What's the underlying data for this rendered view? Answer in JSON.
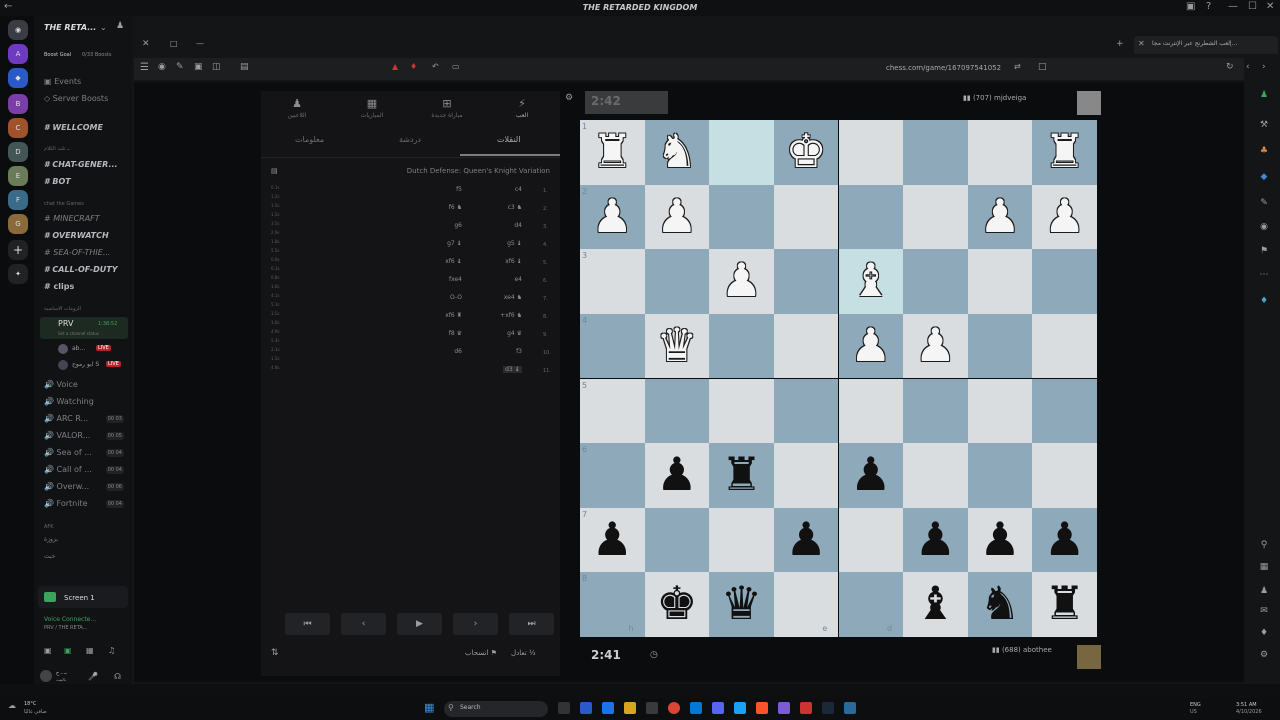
{
  "window": {
    "title": "THE RETARDED KINGDOM",
    "controls": [
      "✕",
      "—",
      "☐",
      "✕"
    ]
  },
  "discord": {
    "server_name": "THE RETA...",
    "boost_goal": "Boost Goal",
    "boosts": "0/33 Boosts",
    "events": "Events",
    "server_boosts": "Server Boosts",
    "channels": [
      {
        "label": "WELLCOME",
        "style": "bold"
      },
      {
        "label": "CHAT-GENER...",
        "style": "bold"
      },
      {
        "label": "BOT",
        "style": "bold"
      },
      {
        "label": "MINECRAFT",
        "style": "dim"
      },
      {
        "label": "OVERWATCH",
        "style": "bold"
      },
      {
        "label": "SEA-OF-THIE...",
        "style": "dim"
      },
      {
        "label": "CALL-OF-DUTY",
        "style": "bold"
      },
      {
        "label": "clips",
        "style": "bold"
      }
    ],
    "categories": {
      "c1": "ــ ثلث الكلام",
      "c2": "chat the Games",
      "c3": "الرومات الاساسية",
      "c4": "AFK"
    },
    "prv": {
      "label": "PRV",
      "time": "1:38:52",
      "status": "Set a channel status",
      "user1": "ab...",
      "user2": "ابو رموح S",
      "live": "LIVE"
    },
    "voice_channels": [
      {
        "label": "Voice",
        "count": ""
      },
      {
        "label": "Watching",
        "count": ""
      },
      {
        "label": "ARC R...",
        "count": "00 03"
      },
      {
        "label": "VALOR...",
        "count": "00 05"
      },
      {
        "label": "Sea of ...",
        "count": "00 04"
      },
      {
        "label": "Call of ...",
        "count": "00 04"
      },
      {
        "label": "Overw...",
        "count": "00 06"
      },
      {
        "label": "Fortnite",
        "count": "00 04"
      }
    ],
    "afk1": "بزوزة",
    "afk2": "خبث",
    "screen": "Screen 1",
    "voice_connected": "Voice Connecte...",
    "voice_path": "PRV / THE RETA...",
    "user_name": "ــ ـ ح",
    "user_status": "بالبيت"
  },
  "browser": {
    "tab_title": "إلعب الشطرنج عبر الإنترنت مجا...",
    "url": "chess.com/game/167097541052"
  },
  "chess": {
    "nav": [
      "العب",
      "مباراة جديدة",
      "المباريات",
      "اللاعبين"
    ],
    "tabs": [
      "النقلات",
      "دردشة",
      "معلومات"
    ],
    "opening": "Dutch Defense: Queen's Knight Variation",
    "moves": [
      {
        "n": "1.",
        "w": "c4",
        "b": "f5"
      },
      {
        "n": "2.",
        "w": "c3 ♞",
        "b": "f6 ♞"
      },
      {
        "n": "3.",
        "w": "d4",
        "b": "g6"
      },
      {
        "n": "4.",
        "w": "g5 ♝",
        "b": "g7 ♝"
      },
      {
        "n": "5.",
        "w": "xf6 ♝",
        "b": "xf6 ♝"
      },
      {
        "n": "6.",
        "w": "e4",
        "b": "fxe4"
      },
      {
        "n": "7.",
        "w": "xe4 ♞",
        "b": "O-O"
      },
      {
        "n": "8.",
        "w": "+xf6 ♞",
        "b": "xf6 ♜"
      },
      {
        "n": "9.",
        "w": "g4 ♛",
        "b": "f8 ♛"
      },
      {
        "n": "10.",
        "w": "f3",
        "b": "d6"
      },
      {
        "n": "11.",
        "w": "d3 ♝",
        "b": ""
      }
    ],
    "times": [
      "0.1s",
      "1.2s",
      "1.5s",
      "1.5s",
      "3.5s",
      "2.9s",
      "1.8s",
      "5.5s",
      "0.9s",
      "6.1s",
      "0.8s",
      "1.6s",
      "4.1s",
      "5.1s",
      "3.5s",
      "1.6s",
      "4.9s",
      "5.4s",
      "2.1s",
      "1.5s",
      "4.8s"
    ],
    "controls_draw": "تعادل ½",
    "controls_resign": "انسحاب ⚑",
    "top_clock": "2:42",
    "bottom_clock": "2:41",
    "top_player": {
      "name": "mjdveiga",
      "rating": "(707)"
    },
    "bottom_player": {
      "name": "abothee",
      "rating": "(688)"
    },
    "ranks": [
      "1",
      "2",
      "3",
      "4",
      "5",
      "6",
      "7",
      "8"
    ],
    "files": [
      "h",
      "e",
      "d"
    ],
    "pieces": [
      {
        "s": "♜",
        "c": "w",
        "r": 0,
        "f": 0
      },
      {
        "s": "♞",
        "c": "w",
        "r": 0,
        "f": 1
      },
      {
        "s": "♚",
        "c": "w",
        "r": 0,
        "f": 3
      },
      {
        "s": "♜",
        "c": "w",
        "r": 0,
        "f": 7
      },
      {
        "s": "♟",
        "c": "w",
        "r": 1,
        "f": 0
      },
      {
        "s": "♟",
        "c": "w",
        "r": 1,
        "f": 1
      },
      {
        "s": "♟",
        "c": "w",
        "r": 1,
        "f": 6
      },
      {
        "s": "♟",
        "c": "w",
        "r": 1,
        "f": 7
      },
      {
        "s": "♟",
        "c": "w",
        "r": 2,
        "f": 2
      },
      {
        "s": "♝",
        "c": "w",
        "r": 2,
        "f": 4
      },
      {
        "s": "♛",
        "c": "w",
        "r": 3,
        "f": 1
      },
      {
        "s": "♟",
        "c": "w",
        "r": 3,
        "f": 4
      },
      {
        "s": "♟",
        "c": "w",
        "r": 3,
        "f": 5
      },
      {
        "s": "♟",
        "c": "k",
        "r": 5,
        "f": 1
      },
      {
        "s": "♜",
        "c": "k",
        "r": 5,
        "f": 2
      },
      {
        "s": "♟",
        "c": "k",
        "r": 5,
        "f": 4
      },
      {
        "s": "♟",
        "c": "k",
        "r": 6,
        "f": 0
      },
      {
        "s": "♟",
        "c": "k",
        "r": 6,
        "f": 3
      },
      {
        "s": "♟",
        "c": "k",
        "r": 6,
        "f": 5
      },
      {
        "s": "♟",
        "c": "k",
        "r": 6,
        "f": 6
      },
      {
        "s": "♟",
        "c": "k",
        "r": 6,
        "f": 7
      },
      {
        "s": "♚",
        "c": "k",
        "r": 7,
        "f": 1
      },
      {
        "s": "♛",
        "c": "k",
        "r": 7,
        "f": 2
      },
      {
        "s": "♝",
        "c": "k",
        "r": 7,
        "f": 5
      },
      {
        "s": "♞",
        "c": "k",
        "r": 7,
        "f": 6
      },
      {
        "s": "♜",
        "c": "k",
        "r": 7,
        "f": 7
      }
    ],
    "highlight": [
      {
        "r": 0,
        "f": 2
      },
      {
        "r": 2,
        "f": 4
      }
    ],
    "colors": {
      "light": "#d9dde0",
      "dark": "#8ea9ba",
      "highlight": "#c5dfe3"
    }
  },
  "taskbar": {
    "weather": "18°C",
    "weather_sub": "صافي غالبًا",
    "search": "Search",
    "lang": "ENG",
    "lang2": "US",
    "time": "3:51 AM",
    "date": "4/10/2026"
  }
}
